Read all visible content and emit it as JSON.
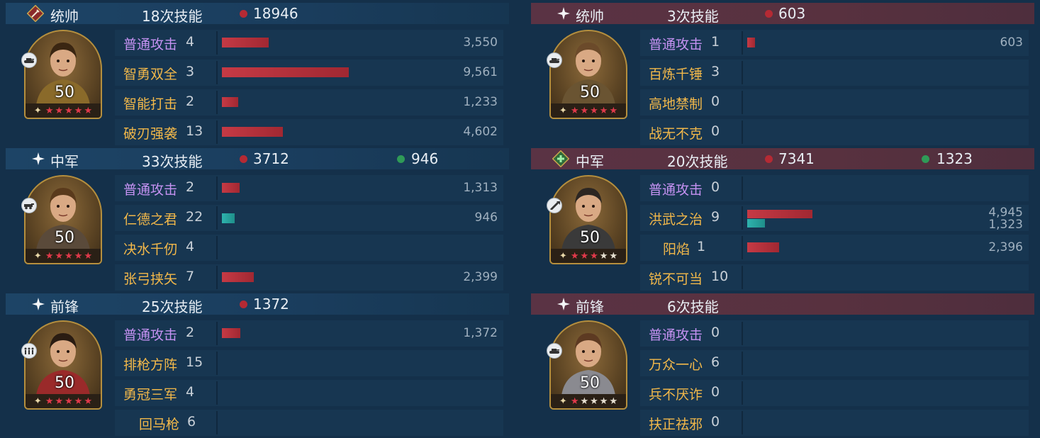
{
  "colors": {
    "damage_dot": "#b52a34",
    "heal_dot": "#2f9a57",
    "damage_bar": "#c63a45",
    "heal_bar": "#2eb3ae",
    "basic_skill": "#c592f2",
    "skill": "#f2b84a"
  },
  "left": {
    "sections": [
      {
        "position": "统帅",
        "emblem_icon": "sword-emblem-icon",
        "count_text": "18次技能",
        "damage": "18946",
        "heal": "",
        "level": "50",
        "red_stars": 5,
        "unit_icon": "tank-icon",
        "skills": [
          {
            "name": "普通攻击",
            "times": "4",
            "dmg": "3,550",
            "dmg_value": 3550,
            "heal": "",
            "heal_value": 0,
            "basic": true
          },
          {
            "name": "智勇双全",
            "times": "3",
            "dmg": "9,561",
            "dmg_value": 9561,
            "heal": "",
            "heal_value": 0,
            "basic": false
          },
          {
            "name": "智能打击",
            "times": "2",
            "dmg": "1,233",
            "dmg_value": 1233,
            "heal": "",
            "heal_value": 0,
            "basic": false
          },
          {
            "name": "破刃强袭",
            "times": "13",
            "dmg": "4,602",
            "dmg_value": 4602,
            "heal": "",
            "heal_value": 0,
            "basic": false
          }
        ]
      },
      {
        "position": "中军",
        "emblem_icon": "star-emblem-icon",
        "count_text": "33次技能",
        "damage": "3712",
        "heal": "946",
        "level": "50",
        "red_stars": 5,
        "unit_icon": "vehicle-icon",
        "skills": [
          {
            "name": "普通攻击",
            "times": "2",
            "dmg": "1,313",
            "dmg_value": 1313,
            "heal": "",
            "heal_value": 0,
            "basic": true
          },
          {
            "name": "仁德之君",
            "times": "22",
            "dmg": "",
            "dmg_value": 0,
            "heal": "946",
            "heal_value": 946,
            "basic": false
          },
          {
            "name": "决水千仞",
            "times": "4",
            "dmg": "",
            "dmg_value": 0,
            "heal": "",
            "heal_value": 0,
            "basic": false
          },
          {
            "name": "张弓挟矢",
            "times": "7",
            "dmg": "2,399",
            "dmg_value": 2399,
            "heal": "",
            "heal_value": 0,
            "basic": false
          }
        ]
      },
      {
        "position": "前锋",
        "emblem_icon": "star-emblem-icon",
        "count_text": "25次技能",
        "damage": "1372",
        "heal": "",
        "level": "50",
        "red_stars": 5,
        "unit_icon": "infantry-icon",
        "skills": [
          {
            "name": "普通攻击",
            "times": "2",
            "dmg": "1,372",
            "dmg_value": 1372,
            "heal": "",
            "heal_value": 0,
            "basic": true
          },
          {
            "name": "排枪方阵",
            "times": "15",
            "dmg": "",
            "dmg_value": 0,
            "heal": "",
            "heal_value": 0,
            "basic": false
          },
          {
            "name": "勇冠三军",
            "times": "4",
            "dmg": "",
            "dmg_value": 0,
            "heal": "",
            "heal_value": 0,
            "basic": false
          },
          {
            "name": "回马枪",
            "times": "6",
            "dmg": "",
            "dmg_value": 0,
            "heal": "",
            "heal_value": 0,
            "basic": false
          }
        ]
      }
    ]
  },
  "right": {
    "sections": [
      {
        "position": "统帅",
        "emblem_icon": "star-emblem-icon",
        "count_text": "3次技能",
        "damage": "603",
        "heal": "",
        "level": "50",
        "red_stars": 5,
        "unit_icon": "tank-icon",
        "skills": [
          {
            "name": "普通攻击",
            "times": "1",
            "dmg": "603",
            "dmg_value": 603,
            "heal": "",
            "heal_value": 0,
            "basic": true
          },
          {
            "name": "百炼千锤",
            "times": "3",
            "dmg": "",
            "dmg_value": 0,
            "heal": "",
            "heal_value": 0,
            "basic": false
          },
          {
            "name": "高地禁制",
            "times": "0",
            "dmg": "",
            "dmg_value": 0,
            "heal": "",
            "heal_value": 0,
            "basic": false
          },
          {
            "name": "战无不克",
            "times": "0",
            "dmg": "",
            "dmg_value": 0,
            "heal": "",
            "heal_value": 0,
            "basic": false
          }
        ]
      },
      {
        "position": "中军",
        "emblem_icon": "healer-emblem-icon",
        "count_text": "20次技能",
        "damage": "7341",
        "heal": "1323",
        "level": "50",
        "red_stars": 3,
        "unit_icon": "rocket-icon",
        "skills": [
          {
            "name": "普通攻击",
            "times": "0",
            "dmg": "",
            "dmg_value": 0,
            "heal": "",
            "heal_value": 0,
            "basic": true
          },
          {
            "name": "洪武之治",
            "times": "9",
            "dmg": "4,945",
            "dmg_value": 4945,
            "heal": "1,323",
            "heal_value": 1323,
            "basic": false
          },
          {
            "name": "阳焰",
            "times": "1",
            "dmg": "2,396",
            "dmg_value": 2396,
            "heal": "",
            "heal_value": 0,
            "basic": false
          },
          {
            "name": "锐不可当",
            "times": "10",
            "dmg": "",
            "dmg_value": 0,
            "heal": "",
            "heal_value": 0,
            "basic": false
          }
        ]
      },
      {
        "position": "前锋",
        "emblem_icon": "star-emblem-icon",
        "count_text": "6次技能",
        "damage": "",
        "heal": "",
        "level": "50",
        "red_stars": 1,
        "unit_icon": "tank-icon",
        "skills": [
          {
            "name": "普通攻击",
            "times": "0",
            "dmg": "",
            "dmg_value": 0,
            "heal": "",
            "heal_value": 0,
            "basic": true
          },
          {
            "name": "万众一心",
            "times": "6",
            "dmg": "",
            "dmg_value": 0,
            "heal": "",
            "heal_value": 0,
            "basic": false
          },
          {
            "name": "兵不厌诈",
            "times": "0",
            "dmg": "",
            "dmg_value": 0,
            "heal": "",
            "heal_value": 0,
            "basic": false
          },
          {
            "name": "扶正祛邪",
            "times": "0",
            "dmg": "",
            "dmg_value": 0,
            "heal": "",
            "heal_value": 0,
            "basic": false
          }
        ]
      }
    ]
  }
}
